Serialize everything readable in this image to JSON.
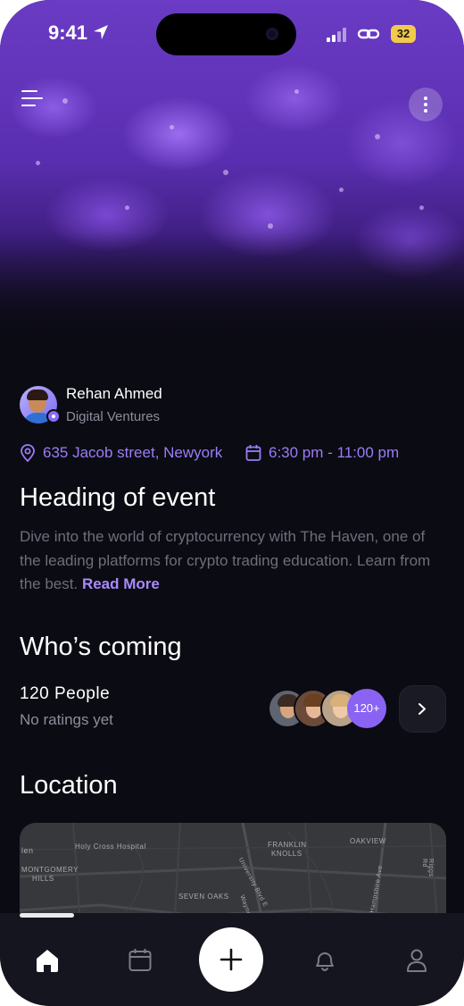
{
  "status_bar": {
    "time": "9:41",
    "battery": "32"
  },
  "organizer": {
    "name": "Rehan Ahmed",
    "company": "Digital Ventures"
  },
  "event": {
    "address": "635 Jacob street, Newyork",
    "time_range": "6:30 pm - 11:00 pm",
    "title": "Heading of event",
    "description": "Dive into the world of cryptocurrency with The Haven, one of the leading platforms for crypto trading education. Learn from the best.",
    "read_more": "Read More"
  },
  "whos_coming": {
    "heading": "Who’s coming",
    "people": "120 People",
    "ratings": "No ratings yet",
    "more_count": "120+"
  },
  "location": {
    "heading": "Location",
    "map_labels": [
      "len",
      "Holy Cross Hospital",
      "MONTGOMERY",
      "HILLS",
      "FRANKLIN",
      "KNOLLS",
      "OAKVIEW",
      "University Blvd E",
      "SEVEN OAKS",
      "Wayne Ave",
      "Hampshire Ave",
      "Riggs Rd"
    ]
  },
  "nav": {
    "items": [
      "home-icon",
      "calendar-icon",
      "plus-icon",
      "bell-icon",
      "profile-icon"
    ]
  },
  "colors": {
    "background": "#0b0b13",
    "accent": "#8a63f5",
    "accent_text": "#9b7cf8",
    "nav_background": "#151520"
  }
}
